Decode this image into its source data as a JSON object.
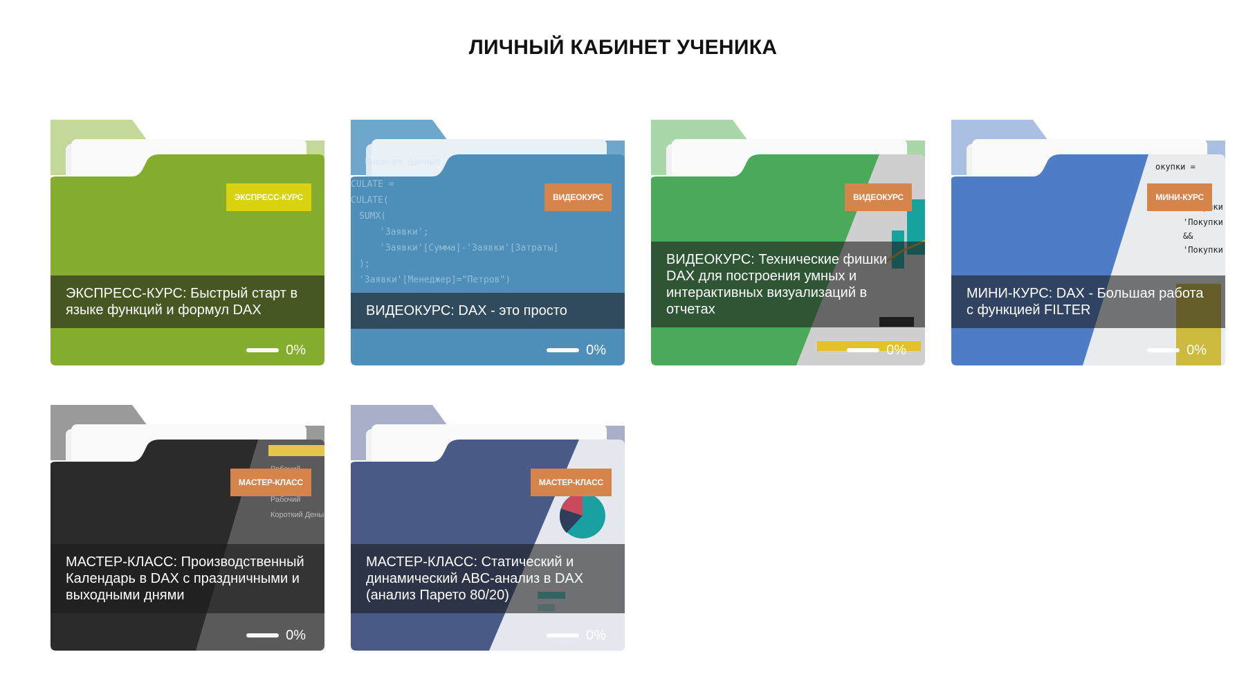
{
  "page": {
    "title": "ЛИЧНЫЙ КАБИНЕТ УЧЕНИКА"
  },
  "courses": [
    {
      "title": "ЭКСПРЕСС-КУРС: Быстрый старт в языке функций и формул DAX",
      "badge": "ЭКСПРЕСС-КУРС",
      "badge_color": "#d8d20f",
      "progress_text": "0%",
      "progress_value": 0,
      "color_main": "#84ad2d",
      "color_tab": "#c2d99a",
      "color_shade": "#6e9224",
      "thumbnail": "none"
    },
    {
      "title": "ВИДЕОКУРС: DAX - это просто",
      "badge": "ВИДЕОКУРС",
      "badge_color": "#d7844c",
      "progress_text": "0%",
      "progress_value": 0,
      "color_main": "#4e8fb9",
      "color_tab": "#6ea6cc",
      "color_shade": "#3e7aa3",
      "thumbnail": "code-snippet"
    },
    {
      "title": "ВИДЕОКУРС: Технические фишки DAX для построения умных и интерактивных визуализаций в отчетах",
      "badge": "ВИДЕОКУРС",
      "badge_color": "#d7844c",
      "progress_text": "0%",
      "progress_value": 0,
      "color_main": "#4aaa5a",
      "color_tab": "#a9d7a9",
      "color_shade": "#3c9249",
      "thumbnail": "report-screenshot"
    },
    {
      "title": "МИНИ-КУРС: DAX - Большая работа с функцией FILTER",
      "badge": "МИНИ-КУРС",
      "badge_color": "#d7844c",
      "progress_text": "0%",
      "progress_value": 0,
      "color_main": "#4f7cc6",
      "color_tab": "#a9c0e3",
      "color_shade": "#4069ad",
      "thumbnail": "formula-screenshot"
    },
    {
      "title": "МАСТЕР-КЛАСС: Производственный Календарь в DAX с праздничными и выходными днями",
      "badge": "МАСТЕР-КЛАСС",
      "badge_color": "#d7844c",
      "progress_text": "0%",
      "progress_value": 0,
      "color_main": "#2b2b2b",
      "color_tab": "#9a9a9a",
      "color_shade": "#1f1f1f",
      "thumbnail": "calendar-table"
    },
    {
      "title": "МАСТЕР-КЛАСС: Статический и динамический ABC-анализ в DAX (анализ Парето 80/20)",
      "badge": "МАСТЕР-КЛАСС",
      "badge_color": "#d7844c",
      "progress_text": "0%",
      "progress_value": 0,
      "color_main": "#4a5a86",
      "color_tab": "#a9afc9",
      "color_shade": "#3d4b73",
      "thumbnail": "pie-chart-report"
    }
  ]
}
